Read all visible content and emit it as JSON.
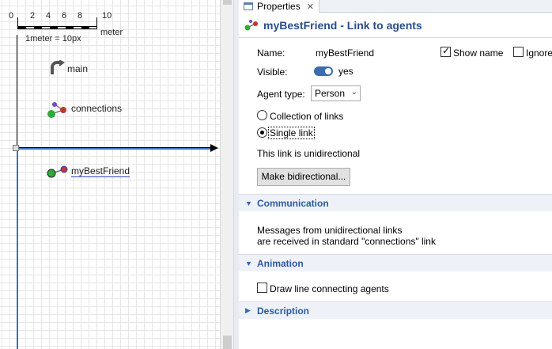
{
  "canvas": {
    "ruler_numbers": [
      "0",
      "2",
      "4",
      "6",
      "8",
      "10"
    ],
    "scale_unit": "meter",
    "scale_text": "1meter = 10px",
    "items": [
      {
        "label": "main"
      },
      {
        "label": "connections"
      },
      {
        "label": "myBestFriend"
      }
    ]
  },
  "tab": {
    "title": "Properties",
    "close": "✕"
  },
  "header": {
    "title": "myBestFriend - Link to agents"
  },
  "properties": {
    "name_label": "Name:",
    "name_value": "myBestFriend",
    "show_name_label": "Show name",
    "show_name_checked": true,
    "ignore_label": "Ignore",
    "visible_label": "Visible:",
    "visible_value": "yes",
    "agent_type_label": "Agent type:",
    "agent_type_value": "Person",
    "radio_collection": "Collection of links",
    "radio_single": "Single link",
    "selected_option": "Single link",
    "direction_text": "This link is unidirectional",
    "make_bidirectional_button": "Make bidirectional..."
  },
  "communication": {
    "title": "Communication",
    "line1": "Messages from unidirectional links",
    "line2": "are received in standard \"connections\" link"
  },
  "animation": {
    "title": "Animation",
    "draw_line_label": "Draw line connecting agents",
    "draw_line_checked": false
  },
  "description": {
    "title": "Description"
  },
  "colors": {
    "header_text": "#2a4e89",
    "section_text": "#2a5aa0",
    "axis_blue": "#3a73b8",
    "toggle_on": "#3c6bb0"
  }
}
